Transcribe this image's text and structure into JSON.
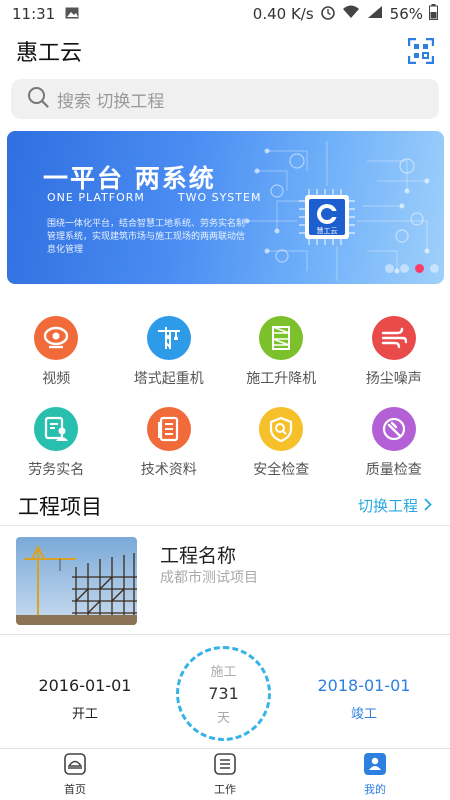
{
  "status_bar": {
    "time": "11:31",
    "speed": "0.40 K/s",
    "battery": "56%"
  },
  "header": {
    "title": "惠工云",
    "scan_icon": "scan-icon"
  },
  "search": {
    "placeholder": "搜索 切换工程",
    "icon": "search-icon"
  },
  "banner": {
    "title_cn": "一平台 两系统",
    "title_en_1": "ONE PLATFORM",
    "title_en_2": "TWO SYSTEM",
    "desc": "围绕一体化平台，结合智慧工地系统、劳务实名制管理系统，实现建筑市场与施工现场的两两联动信息化管理",
    "chip_label": "慧工云",
    "slides": 4,
    "active_slide": 3
  },
  "grid": {
    "row1": [
      {
        "label": "视频",
        "icon": "video-icon",
        "color": "#f06a3a"
      },
      {
        "label": "塔式起重机",
        "icon": "tower-crane-icon",
        "color": "#2e9be8"
      },
      {
        "label": "施工升降机",
        "icon": "construction-elevator-icon",
        "color": "#7cc02c"
      },
      {
        "label": "扬尘噪声",
        "icon": "dust-noise-icon",
        "color": "#e94b4b"
      }
    ],
    "row2": [
      {
        "label": "劳务实名",
        "icon": "labor-id-icon",
        "color": "#28bfae"
      },
      {
        "label": "技术资料",
        "icon": "tech-docs-icon",
        "color": "#f06a3a"
      },
      {
        "label": "安全检查",
        "icon": "safety-check-icon",
        "color": "#f5c02a"
      },
      {
        "label": "质量检查",
        "icon": "quality-check-icon",
        "color": "#b35fd6"
      }
    ]
  },
  "projects": {
    "title": "工程项目",
    "switch_label": "切换工程"
  },
  "project": {
    "name": "工程名称",
    "subtitle": "成都市测试项目"
  },
  "schedule": {
    "start_date": "2016-01-01",
    "start_label": "开工",
    "end_date": "2018-01-01",
    "end_label": "竣工",
    "ring_top": "施工",
    "days": "731",
    "ring_unit": "天"
  },
  "bottom_nav": {
    "tabs": [
      {
        "label": "首页",
        "icon": "home-icon"
      },
      {
        "label": "工作",
        "icon": "work-list-icon"
      },
      {
        "label": "我的",
        "icon": "profile-icon"
      }
    ],
    "active": 2
  },
  "colors": {
    "accent": "#2aa8e2",
    "nav_active": "#2d7fe0",
    "end_date": "#2d7fe0"
  }
}
